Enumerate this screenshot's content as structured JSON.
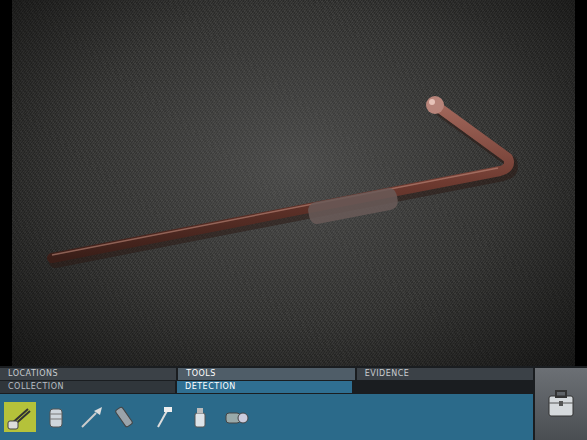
{
  "tabs": [
    {
      "label": "LOCATIONS",
      "selected": false
    },
    {
      "label": "TOOLS",
      "selected": true
    },
    {
      "label": "EVIDENCE",
      "selected": false
    }
  ],
  "subtabs": [
    {
      "label": "COLLECTION",
      "selected": false
    },
    {
      "label": "DETECTION",
      "selected": true
    }
  ],
  "tools": [
    {
      "selected": true
    },
    {
      "selected": false
    },
    {
      "selected": false
    },
    {
      "selected": false
    },
    {
      "selected": false
    },
    {
      "selected": false
    },
    {
      "selected": false
    }
  ]
}
